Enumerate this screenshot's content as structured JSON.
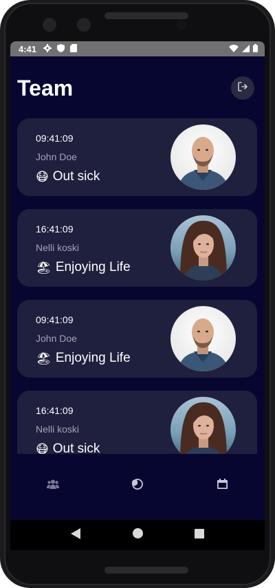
{
  "status_bar": {
    "time": "4:41",
    "icons": [
      "gear-icon",
      "shield-icon",
      "sim-card-icon",
      "wifi-icon",
      "signal-icon",
      "battery-icon"
    ]
  },
  "header": {
    "title": "Team",
    "logout_icon": "logout-icon"
  },
  "entries": [
    {
      "time": "09:41:09",
      "name": "John Doe",
      "status_emoji": "😷",
      "status": "Out sick",
      "avatar": "bald-man"
    },
    {
      "time": "16:41:09",
      "name": "Nelli koski",
      "status_emoji": "🏖",
      "status": "Enjoying Life",
      "avatar": "woman"
    },
    {
      "time": "09:41:09",
      "name": "John Doe",
      "status_emoji": "🏖",
      "status": "Enjoying Life",
      "avatar": "bald-man"
    },
    {
      "time": "16:41:09",
      "name": "Nelli koski",
      "status_emoji": "😷",
      "status": "Out sick",
      "avatar": "woman"
    }
  ],
  "bottom_nav": {
    "items": [
      "team-icon",
      "clock-icon",
      "calendar-icon"
    ]
  },
  "system_nav": [
    "back-icon",
    "home-icon",
    "recents-icon"
  ],
  "colors": {
    "background": "#070631",
    "card": "#1f1f3e",
    "secondary_text": "#a4a4b8"
  }
}
